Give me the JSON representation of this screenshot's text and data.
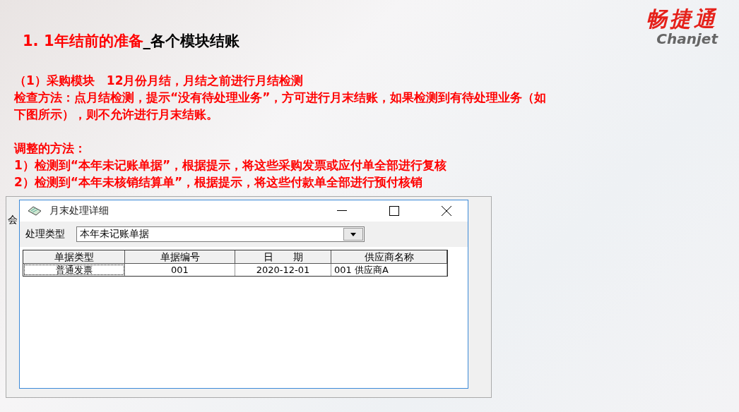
{
  "slide": {
    "title_number": "1. 1年结前的准备",
    "title_rest": "_各个模块结账",
    "logo": {
      "name": "畅捷通",
      "latin": "Chanjet"
    },
    "paragraphs": [
      {
        "lines": [
          "（1）采购模块　12月份月结，月结之前进行月结检测",
          "检查方法：点月结检测，提示“没有待处理业务”，方可进行月末结账，如果检测到有待处理业务（如",
          "下图所示），则不允许进行月末结账。"
        ]
      },
      {
        "lines": [
          "调整的方法：",
          "1）检测到“本年未记账单据”，根据提示，将这些采购发票或应付单全部进行复核",
          "2）检测到“本年未核销结算单”，根据提示，将这些付款单全部进行预付核销"
        ]
      }
    ]
  },
  "background_window": {
    "column_1": "会"
  },
  "window": {
    "title": "月末处理详细",
    "filter_label": "处理类型",
    "filter_value": "本年未记账单据",
    "table": {
      "columns": [
        "单据类型",
        "单据编号",
        "日　　期",
        "供应商名称"
      ],
      "rows": [
        {
          "selected": true,
          "cells": [
            "普通发票",
            "001",
            "2020-12-01",
            "001  供应商A"
          ]
        }
      ]
    }
  }
}
